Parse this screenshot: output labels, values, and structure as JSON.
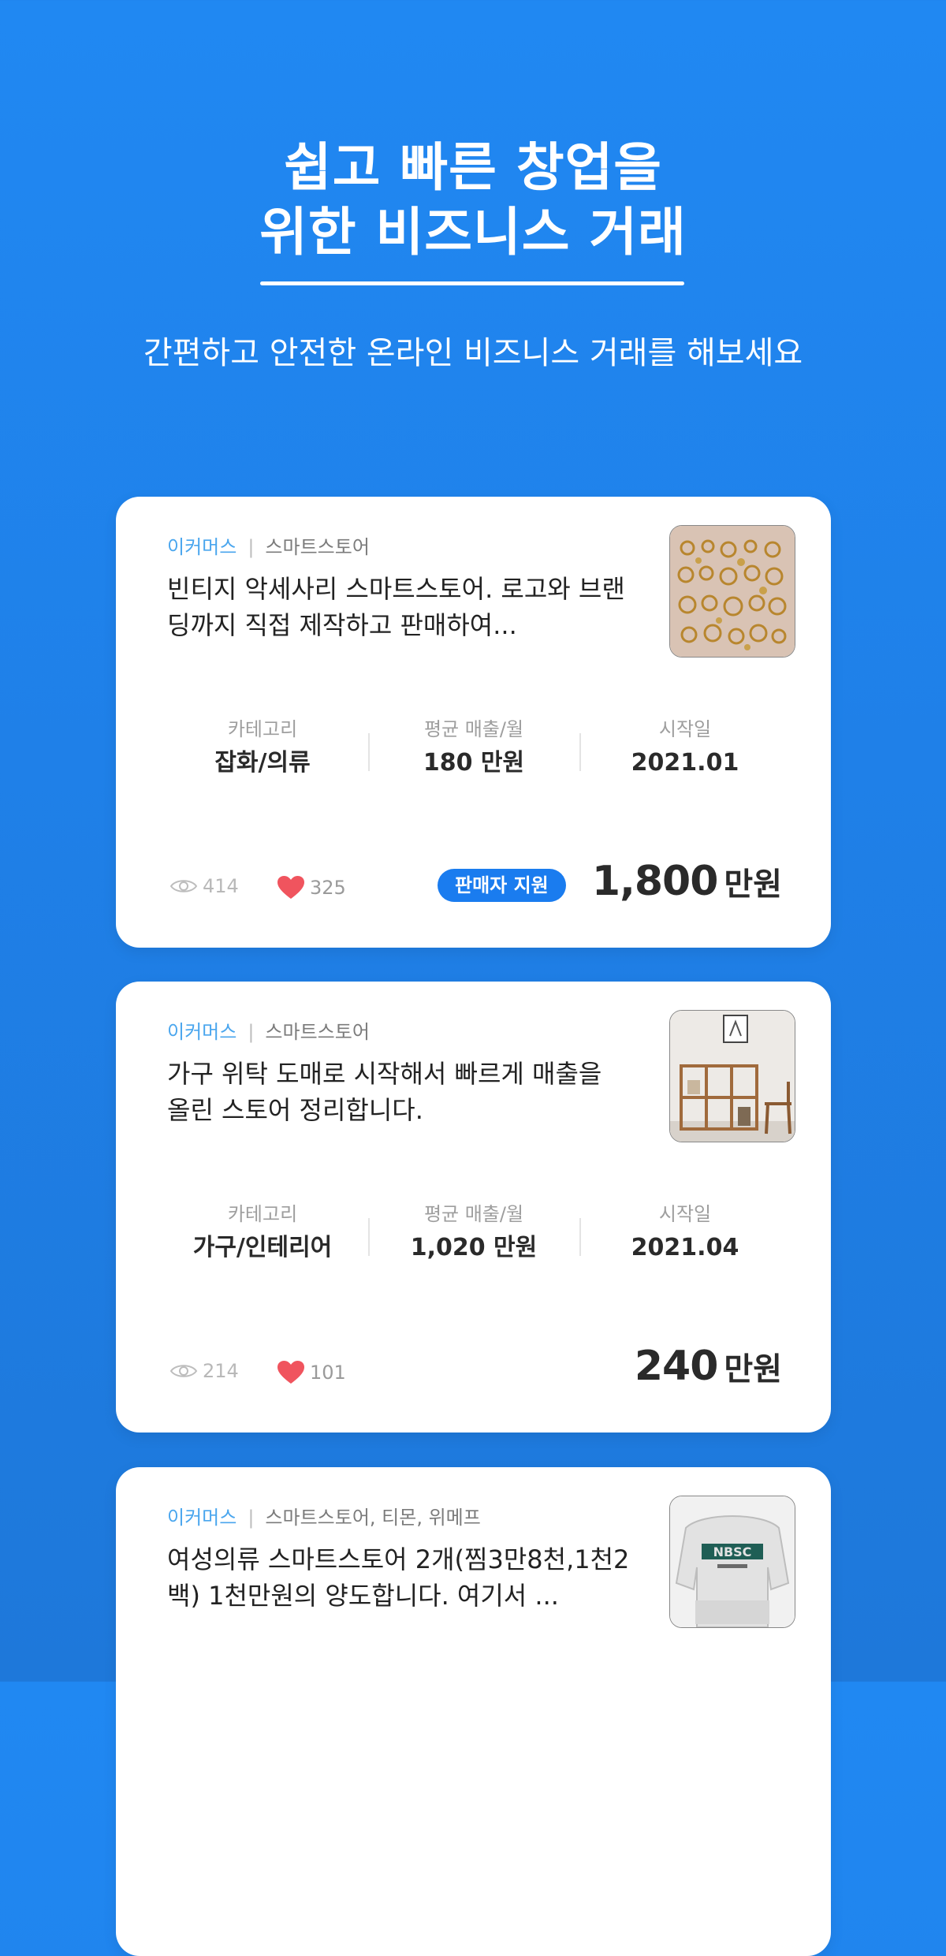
{
  "hero": {
    "title_line1": "쉽고 빠른 창업을",
    "title_line2": "위한 비즈니스 거래",
    "subtitle": "간편하고 안전한 온라인 비즈니스 거래를 해보세요"
  },
  "listings": [
    {
      "category_main": "이커머스",
      "category_sub": "스마트스토어",
      "title": "빈티지 악세사리 스마트스토어. 로고와 브랜딩까지 직접 제작하고 판매하여...",
      "stats": [
        {
          "label": "카테고리",
          "value": "잡화/의류"
        },
        {
          "label": "평균 매출/월",
          "value": "180 만원"
        },
        {
          "label": "시작일",
          "value": "2021.01"
        }
      ],
      "views": "414",
      "likes": "325",
      "badge": "판매자 지원",
      "price": "1,800",
      "price_unit": "만원",
      "thumbnail": "gold-earrings-photo"
    },
    {
      "category_main": "이커머스",
      "category_sub": "스마트스토어",
      "title": "가구 위탁 도매로 시작해서 빠르게 매출을 올린 스토어 정리합니다.",
      "stats": [
        {
          "label": "카테고리",
          "value": "가구/인테리어"
        },
        {
          "label": "평균 매출/월",
          "value": "1,020 만원"
        },
        {
          "label": "시작일",
          "value": "2021.04"
        }
      ],
      "views": "214",
      "likes": "101",
      "price": "240",
      "price_unit": "만원",
      "thumbnail": "wooden-shelf-photo"
    },
    {
      "category_main": "이커머스",
      "category_sub": "스마트스토어, 티몬, 위메프",
      "title": "여성의류 스마트스토어 2개(찜3만8천,1천2백) 1천만원의 양도합니다. 여기서 ...",
      "thumbnail": "sweatshirt-photo"
    }
  ],
  "colors": {
    "accent": "#1A7CEF",
    "tag": "#4AA6EE",
    "heart": "#F0545E"
  }
}
